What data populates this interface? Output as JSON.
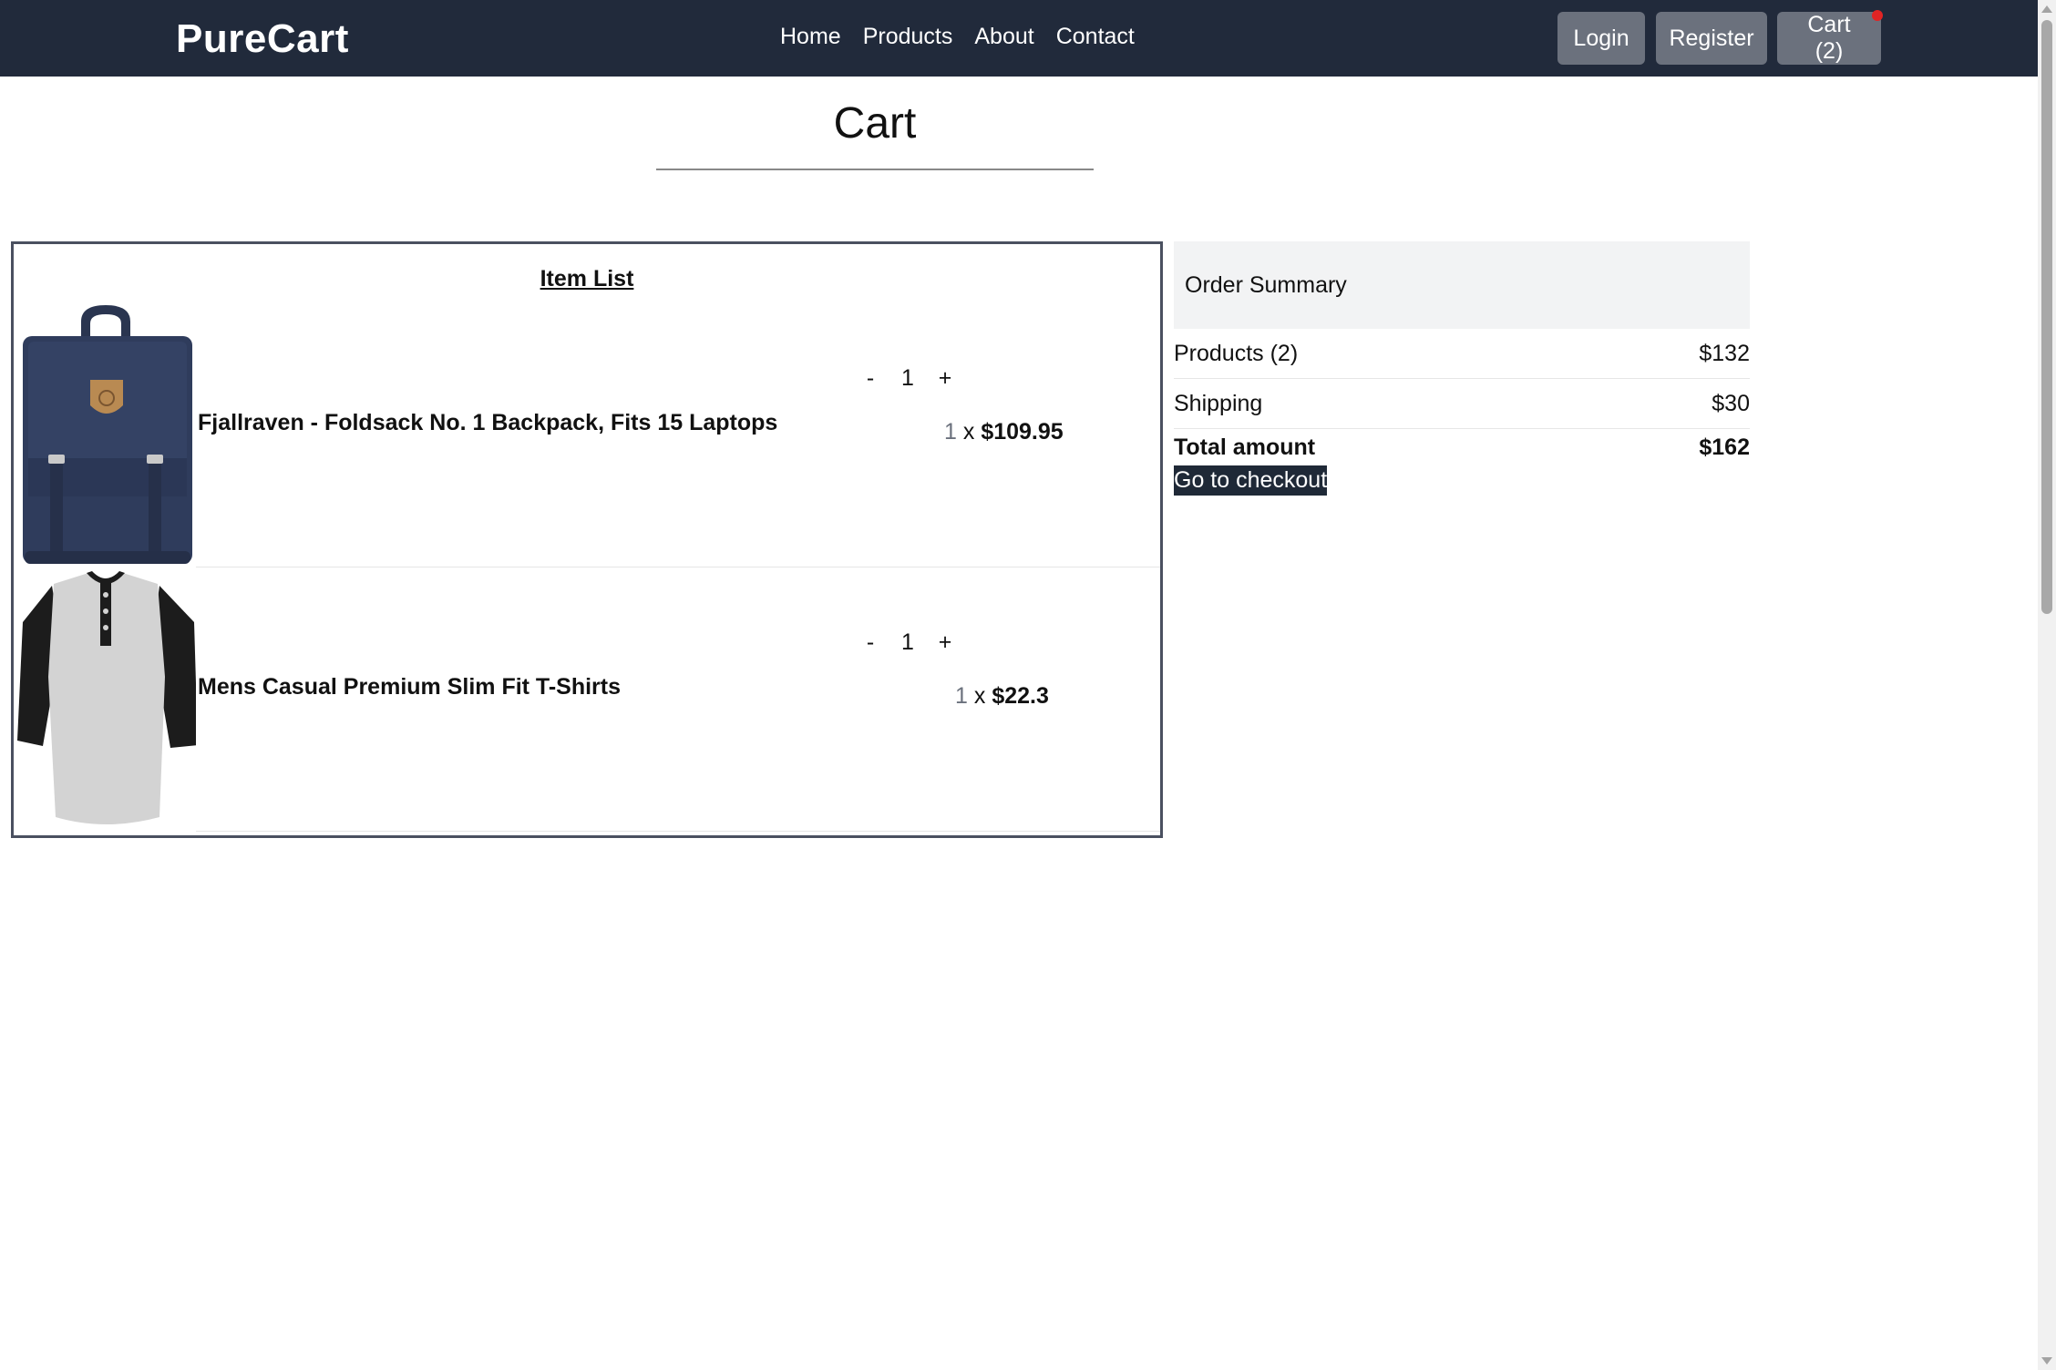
{
  "navbar": {
    "brand": "PureCart",
    "links": [
      "Home",
      "Products",
      "About",
      "Contact"
    ],
    "login_label": "Login",
    "register_label": "Register",
    "cart_label": "Cart (2)"
  },
  "page": {
    "title": "Cart"
  },
  "item_list": {
    "heading": "Item List",
    "items": [
      {
        "name": "Fjallraven - Foldsack No. 1 Backpack, Fits 15 Laptops",
        "image_icon": "backpack-image",
        "minus": "-",
        "plus": "+",
        "quantity": "1",
        "line_qty": "1",
        "line_sep": " x ",
        "unit_price": "$109.95"
      },
      {
        "name": "Mens Casual Premium Slim Fit T-Shirts",
        "image_icon": "tshirt-image",
        "minus": "-",
        "plus": "+",
        "quantity": "1",
        "line_qty": "1",
        "line_sep": " x ",
        "unit_price": "$22.3"
      }
    ]
  },
  "summary": {
    "heading": "Order Summary",
    "products_label": "Products (2)",
    "products_value": "$132",
    "shipping_label": "Shipping",
    "shipping_value": "$30",
    "total_label": "Total amount",
    "total_value": "$162",
    "checkout_label": "Go to checkout"
  },
  "colors": {
    "navbar_bg": "#212a3b",
    "nav_button_bg": "#6b717d",
    "checkout_bg": "#1f2937",
    "cart_badge": "#e02424"
  }
}
